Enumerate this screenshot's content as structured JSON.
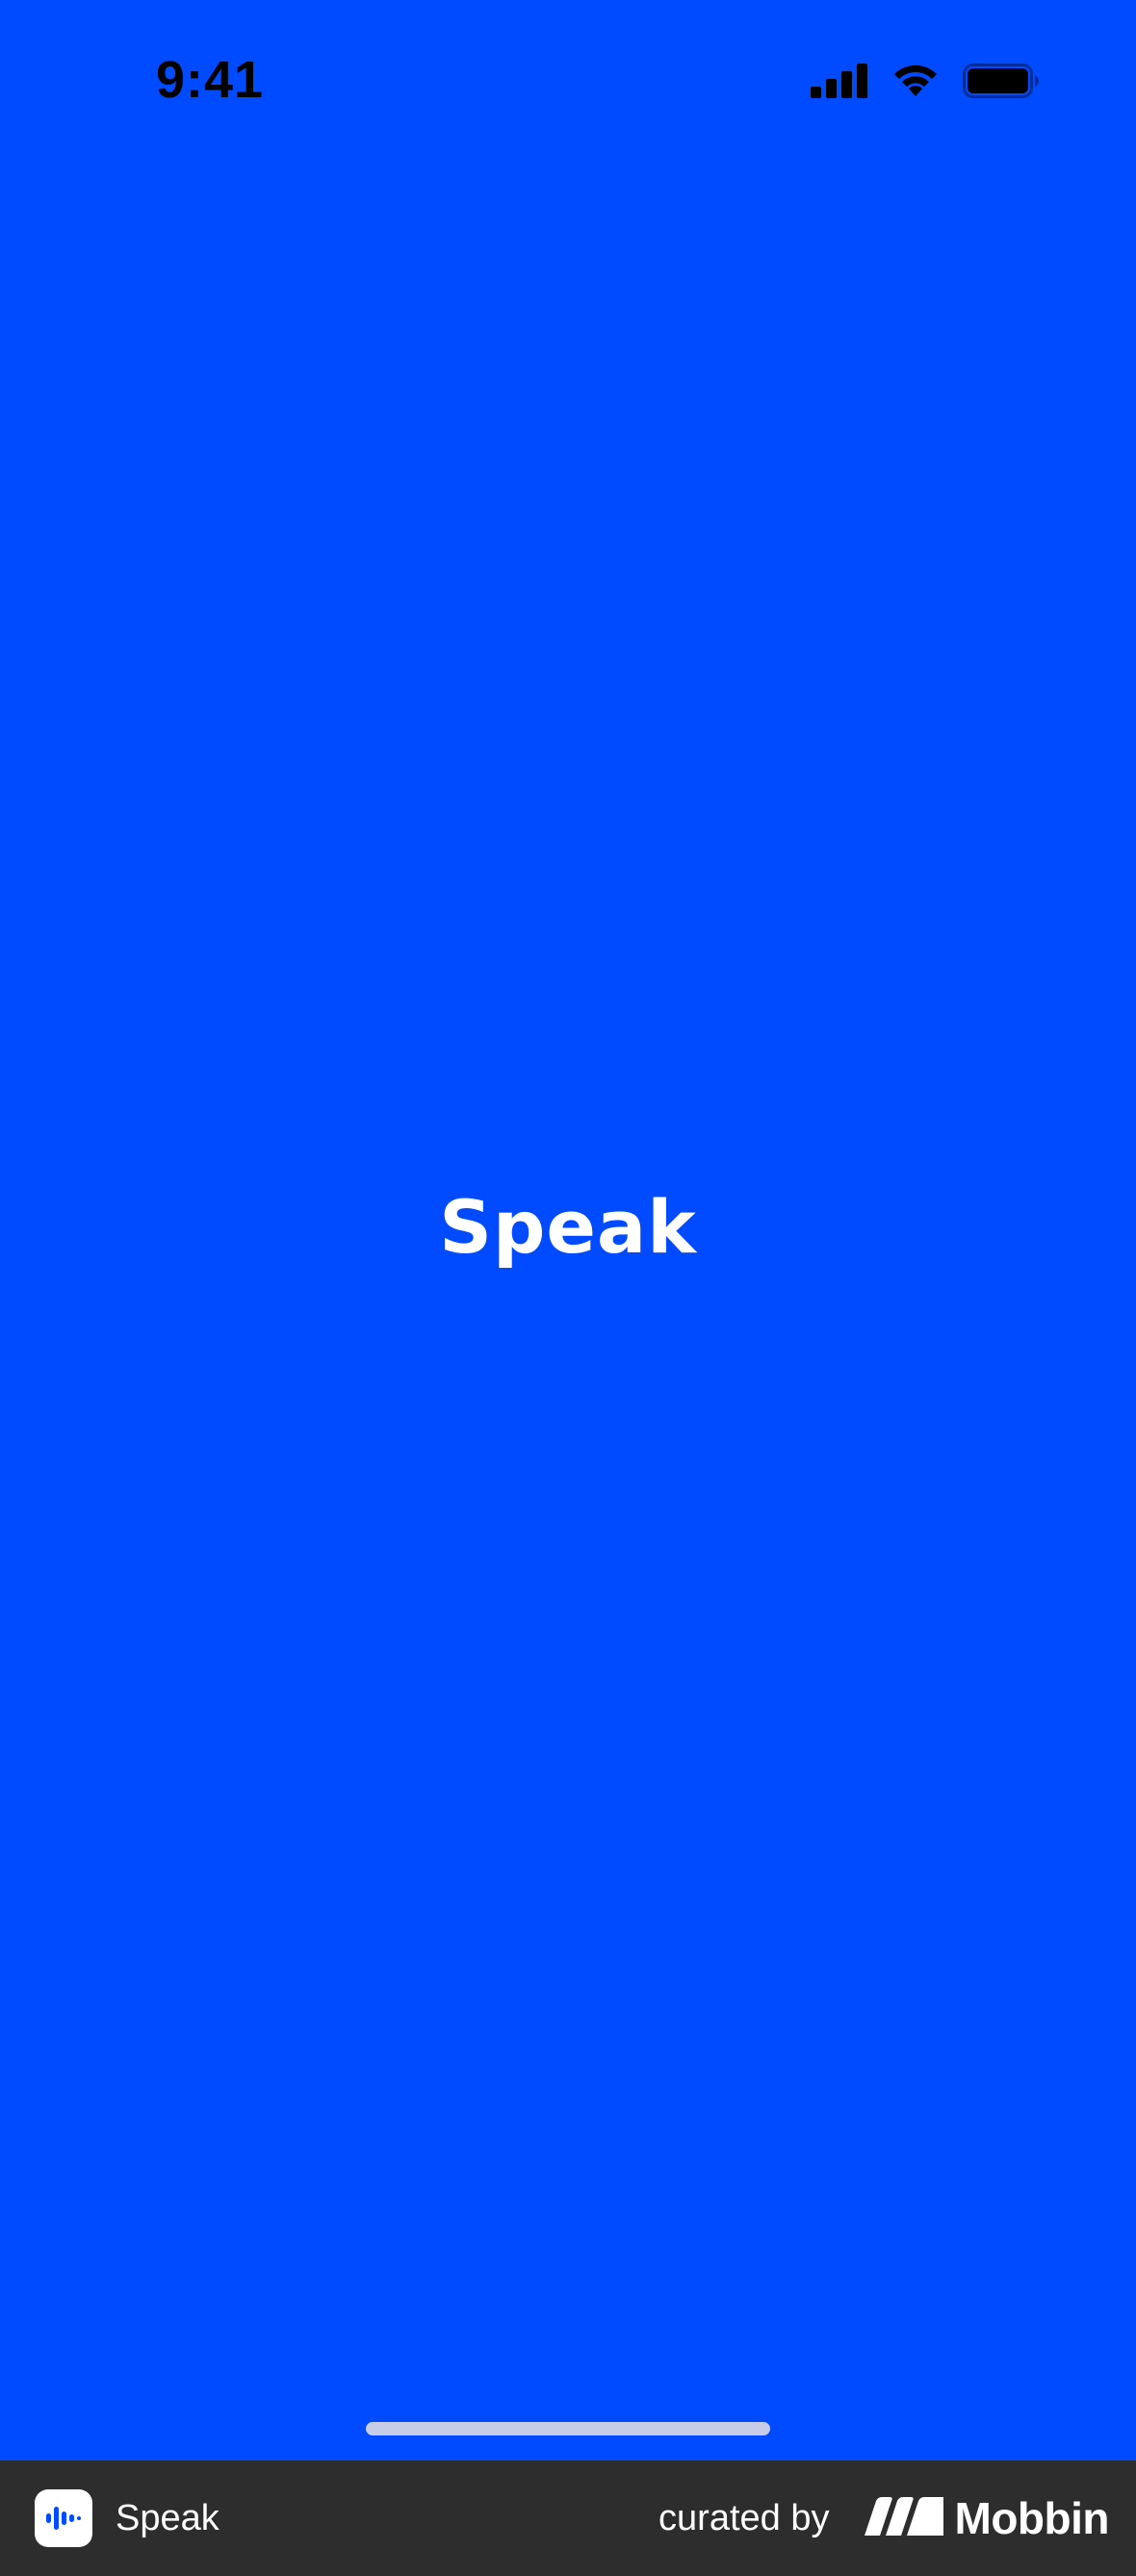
{
  "status_bar": {
    "time": "9:41",
    "icons": [
      "cellular-signal-icon",
      "wifi-icon",
      "battery-icon"
    ]
  },
  "splash": {
    "logo_text": "Speak"
  },
  "footer": {
    "app_name": "Speak",
    "app_icon": "speak-waveform-icon",
    "curated_by": "curated by",
    "brand_name": "Mobbin",
    "brand_icon": "mobbin-logo-icon"
  },
  "colors": {
    "background": "#004bff",
    "status_text": "#000000",
    "logo_text": "#ffffff",
    "home_indicator": "#c7cde6",
    "footer_background": "#2d2d2d",
    "footer_text": "#ffffff"
  }
}
